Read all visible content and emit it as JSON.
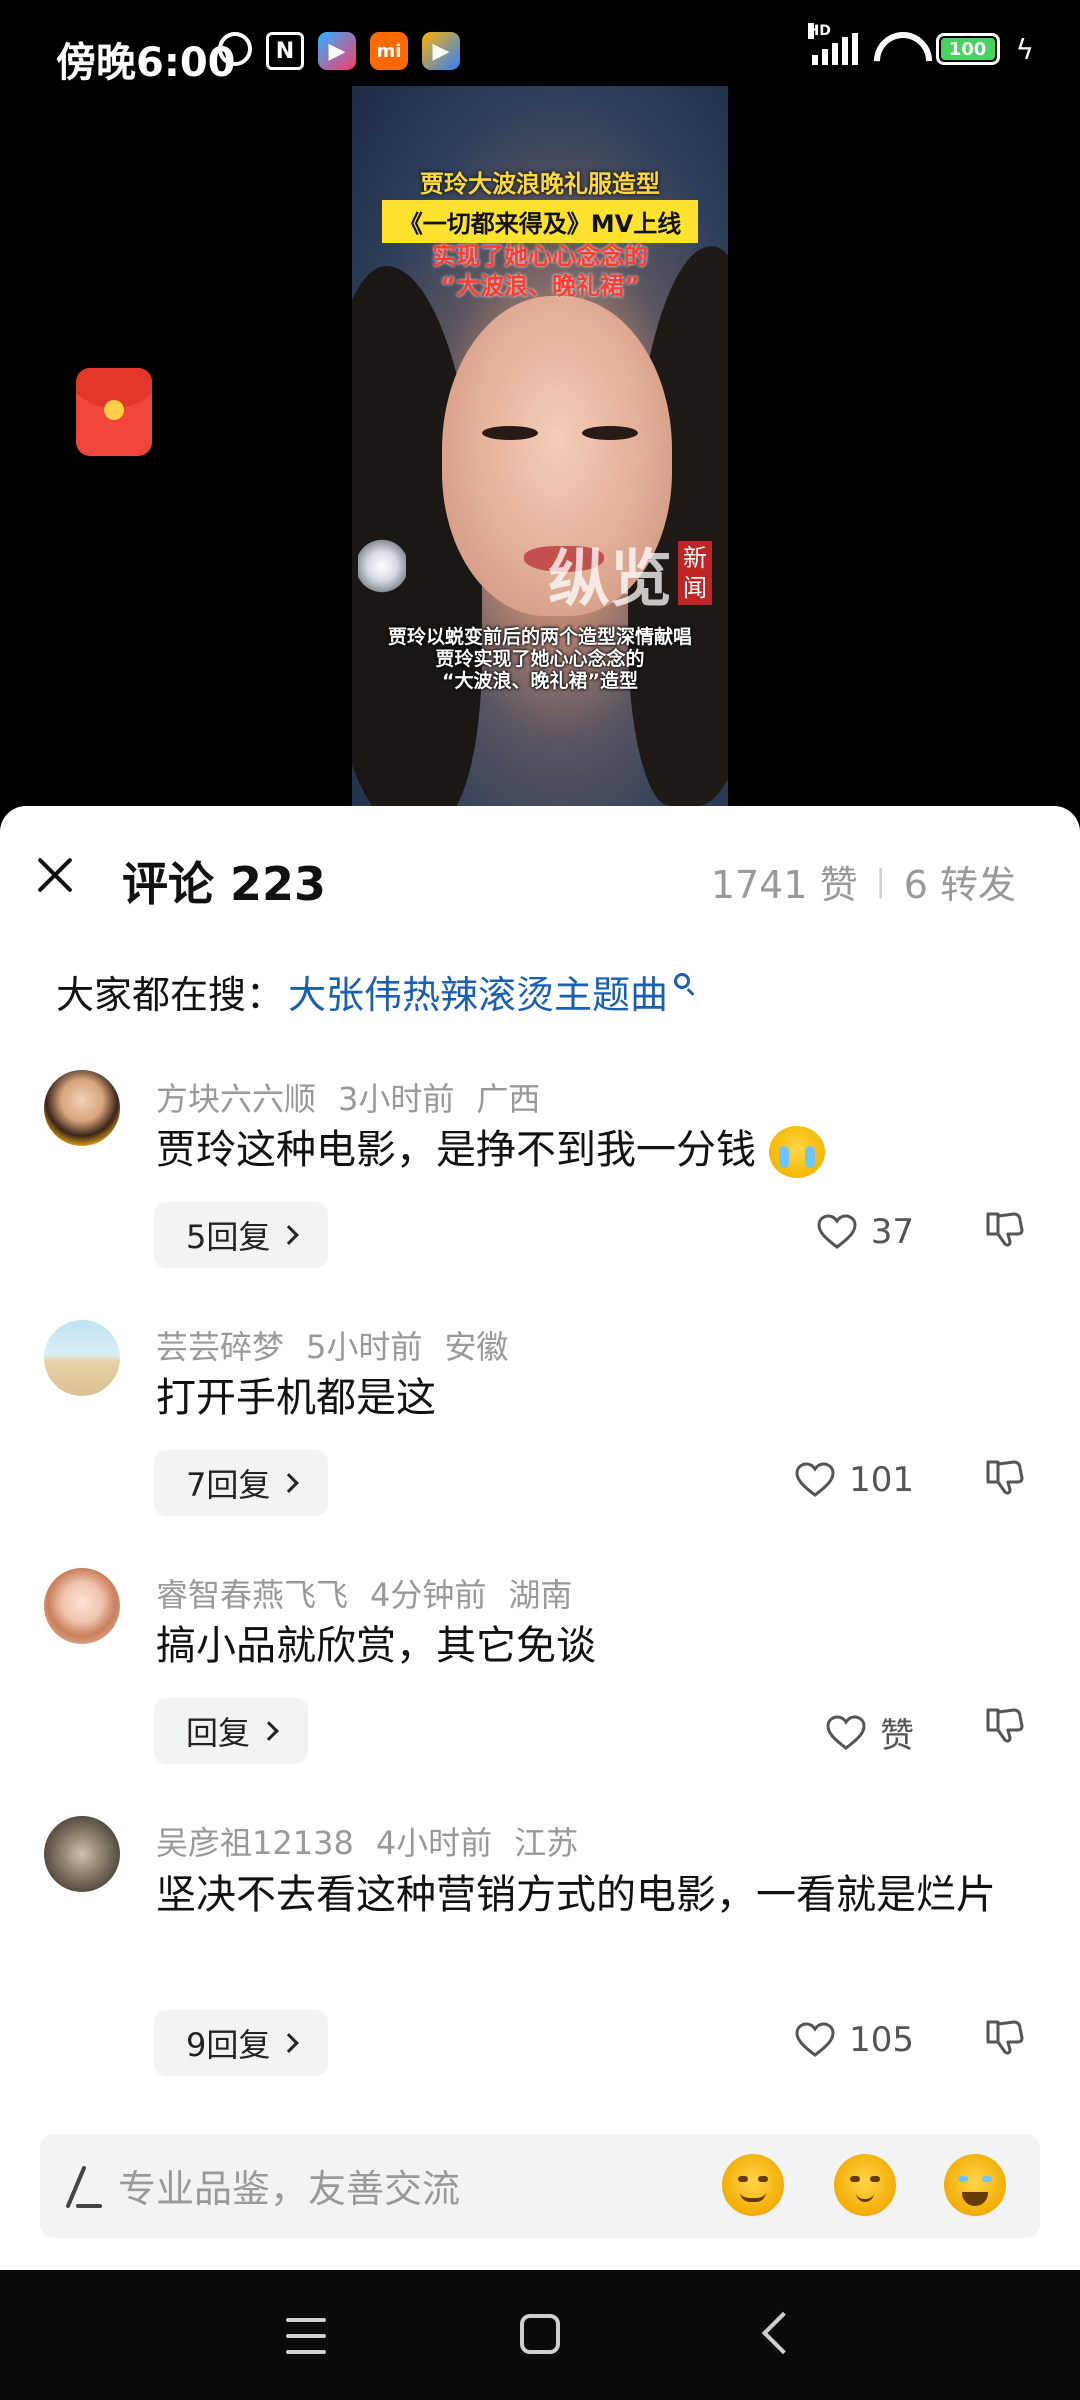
{
  "status_bar": {
    "time": "傍晚6:00",
    "network": "HD",
    "battery": "100",
    "icons": [
      "alarm-icon",
      "nfc-icon",
      "video-app-icon",
      "mi-app-icon",
      "news-app-icon",
      "signal-icon",
      "wifi-icon",
      "battery-icon",
      "charging-icon"
    ]
  },
  "video": {
    "title_line1": "贾玲大波浪晚礼服造型",
    "title_line2": "《一切都来得及》MV上线",
    "title_line3": "实现了她心心念念的",
    "title_line4": "“大波浪、晚礼裙”",
    "watermark": "纵览",
    "watermark_badge": "新闻",
    "caption_line1": "贾玲以蜕变前后的两个造型深情献唱",
    "caption_line2": "贾玲实现了她心心念念的",
    "caption_line3": "“大波浪、晚礼裙”造型"
  },
  "comments_header": {
    "title": "评论 223",
    "likes": "1741 赞",
    "separator": "|",
    "shares": "6 转发"
  },
  "search_hint": {
    "prefix": "大家都在搜：",
    "query": "大张伟热辣滚烫主题曲"
  },
  "comments": [
    {
      "user": "方块六六顺",
      "time": "3小时前",
      "location": "广西",
      "text": "贾玲这种电影，是挣不到我一分钱",
      "emoji": "crying-emoji",
      "replies": "5回复",
      "likes": "37"
    },
    {
      "user": "芸芸碎梦",
      "time": "5小时前",
      "location": "安徽",
      "text": "打开手机都是这",
      "replies": "7回复",
      "likes": "101"
    },
    {
      "user": "睿智春燕飞飞",
      "time": "4分钟前",
      "location": "湖南",
      "text": "搞小品就欣赏，其它免谈",
      "replies": "回复",
      "likes": "赞"
    },
    {
      "user": "吴彦祖12138",
      "time": "4小时前",
      "location": "江苏",
      "text": "坚决不去看这种营销方式的电影，一看就是烂片",
      "replies": "9回复",
      "likes": "105"
    }
  ],
  "input_bar": {
    "placeholder": "专业品鉴，友善交流",
    "emojis": [
      "sleepy-emoji-icon",
      "thinking-emoji-icon",
      "laughing-crying-emoji-icon"
    ]
  },
  "colors": {
    "link": "#1a5fb4",
    "muted": "#999999",
    "sheet_bg": "#ffffff",
    "chip_bg": "#f2f3f5",
    "redpacket": "#f0453a"
  }
}
